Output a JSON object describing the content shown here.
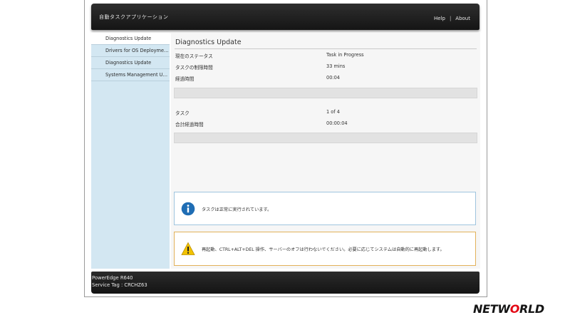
{
  "header": {
    "app_title": "自動タスクアプリケーション",
    "links": {
      "help": "Help",
      "separator": "|",
      "about": "About"
    }
  },
  "sidebar": {
    "items": [
      {
        "label": "Diagnostics Update",
        "active": true
      },
      {
        "label": "Drivers for OS Deployment U...",
        "active": false
      },
      {
        "label": "Diagnostics Update",
        "active": false
      },
      {
        "label": "Systems Management Update",
        "active": false
      }
    ]
  },
  "main": {
    "title": "Diagnostics Update",
    "status_rows": [
      {
        "label": "現在のステータス",
        "value": "Task in Progress"
      },
      {
        "label": "タスクの制限時間",
        "value": "33 mins"
      },
      {
        "label": "経過時間",
        "value": "00:04"
      }
    ],
    "task_rows": [
      {
        "label": "タスク",
        "value": "1 of 4"
      },
      {
        "label": "合計経過時間",
        "value": "00:00:04"
      }
    ],
    "info_message": "タスクは正常に実行されています。",
    "warning_message": "再起動、CTRL+ALT+DEL 操作、サーバーのオフは行わないでください。必要に応じてシステムは自動的に再起動します。"
  },
  "footer": {
    "model": "PowerEdge R640",
    "service_tag": "Service Tag : CRCHZ63"
  },
  "logo": {
    "part1": "NETW",
    "part2": "O",
    "part3": "RLD"
  },
  "icons": {
    "info": "info-icon",
    "warning": "warning-icon"
  },
  "colors": {
    "sidebar_bg": "#d3e7f2",
    "info_blue": "#1f6db4",
    "warning_yellow": "#f2c200",
    "warning_border": "#e2b15a",
    "info_border": "#9fc4de",
    "logo_accent": "#e30613"
  }
}
